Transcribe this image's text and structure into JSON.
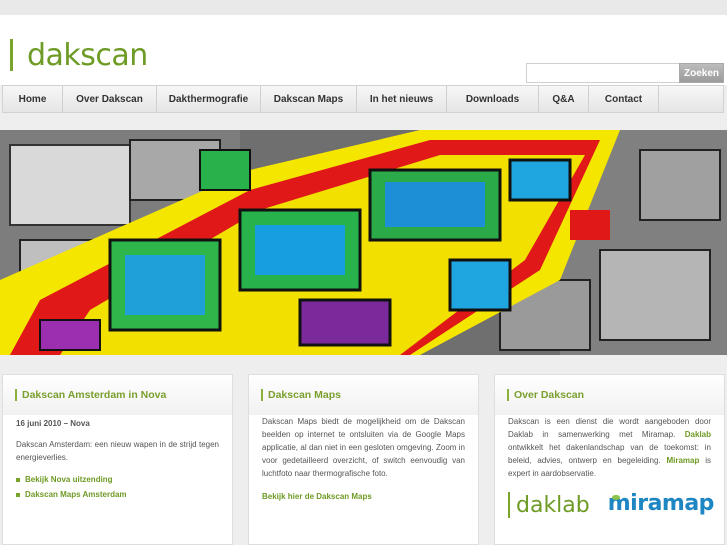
{
  "brand": {
    "logo_text": "dakscan"
  },
  "search": {
    "placeholder": "",
    "button_label": "Zoeken"
  },
  "nav": {
    "items": [
      {
        "label": "Home"
      },
      {
        "label": "Over Dakscan"
      },
      {
        "label": "Dakthermografie"
      },
      {
        "label": "Dakscan Maps"
      },
      {
        "label": "In het nieuws"
      },
      {
        "label": "Downloads"
      },
      {
        "label": "Q&A"
      },
      {
        "label": "Contact"
      }
    ]
  },
  "hero": {
    "image": "thermal-aerial-roof-scan"
  },
  "news": {
    "title": "Dakscan Amsterdam in Nova",
    "date": "16 juni 2010 – Nova",
    "text": "Dakscan Amsterdam: een nieuw wapen in de strijd tegen energieverlies.",
    "links": [
      {
        "label": "Bekijk Nova uitzending"
      },
      {
        "label": "Dakscan Maps Amsterdam"
      }
    ]
  },
  "maps": {
    "title": "Dakscan Maps",
    "text": "Dakscan Maps biedt de mogelijkheid om de Dakscan beelden op internet te ontsluiten via de Google Maps applicatie, al dan niet in een gesloten omgeving. Zoom in voor gedetailleerd overzicht, of switch eenvoudig van luchtfoto naar thermografische foto.",
    "link": "Bekijk hier de Dakscan Maps"
  },
  "about": {
    "title": "Over Dakscan",
    "text_1": "Dakscan is een dienst die wordt aangeboden door Daklab in samenwerking met Miramap.",
    "link_daklab": "Daklab",
    "text_2": "ontwikkelt het dakenlandschap van de toekomst: in beleid, advies, ontwerp en begeleiding.",
    "link_miramap": "Miramap",
    "text_3": "is expert in aardobservatie.",
    "logo_daklab": "daklab",
    "logo_miramap": "miramap"
  },
  "colors": {
    "brand_green": "#6e9b25",
    "miramap_blue": "#1e86c2"
  }
}
